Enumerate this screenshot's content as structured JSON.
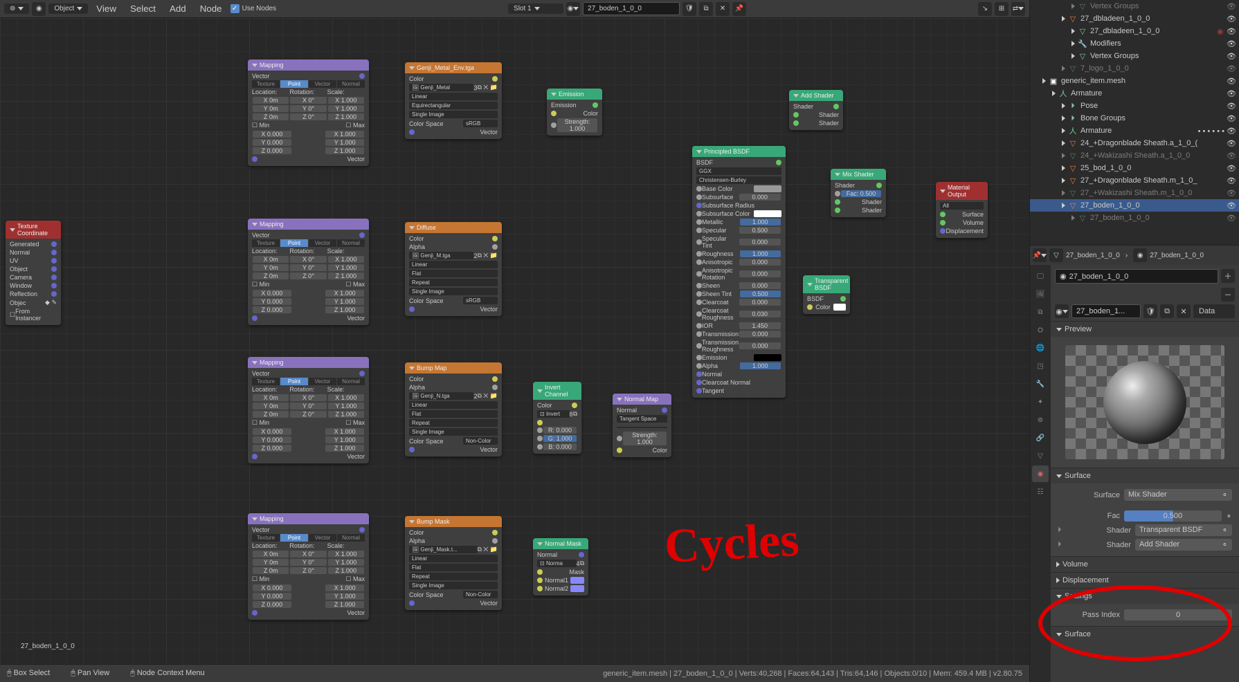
{
  "header": {
    "mode_label": "Object",
    "menu_view": "View",
    "menu_select": "Select",
    "menu_add": "Add",
    "menu_node": "Node",
    "use_nodes": "Use Nodes",
    "slot": "Slot 1",
    "material": "27_boden_1_0_0"
  },
  "breadcrumb": "27_boden_1_0_0",
  "tex_coord": {
    "title": "Texture Coordinate",
    "outs": [
      "Generated",
      "Normal",
      "UV",
      "Object",
      "Camera",
      "Window",
      "Reflection"
    ],
    "obj_lbl": "Objec",
    "inst": "From Instancer"
  },
  "mapping": {
    "title": "Mapping",
    "out": "Vector",
    "types": [
      "Texture",
      "Point",
      "Vector",
      "Normal"
    ],
    "loc": "Location:",
    "rot": "Rotation:",
    "scale": "Scale:",
    "xyz": [
      "X",
      "Y",
      "Z"
    ],
    "zeros": [
      "0m",
      "0°",
      "1.000"
    ],
    "min_lbl": "Min",
    "max_lbl": "Max",
    "minv": "0.000",
    "maxv": "1.000",
    "vec_in": "Vector"
  },
  "img_env": {
    "title": "Genji_Metal_Env.tga",
    "out": "Color",
    "name": "Genji_Metal",
    "users": "3",
    "interp": "Linear",
    "proj": "Equirectangular",
    "single": "Single Image",
    "cspace": "Color Space",
    "cs": "sRGB",
    "vec": "Vector"
  },
  "img_m": {
    "title": "Diffuse",
    "out": "Color",
    "out2": "Alpha",
    "name": "Genji_M.tga",
    "users": "2",
    "interp": "Linear",
    "proj": "Flat",
    "rep": "Repeat",
    "single": "Single Image",
    "cspace": "Color Space",
    "cs": "sRGB",
    "vec": "Vector"
  },
  "img_n": {
    "title": "Bump Map",
    "out": "Color",
    "out2": "Alpha",
    "name": "Genji_N.tga",
    "users": "2",
    "interp": "Linear",
    "proj": "Flat",
    "rep": "Repeat",
    "single": "Single Image",
    "cspace": "Color Space",
    "cs": "Non-Color",
    "vec": "Vector"
  },
  "img_mask": {
    "title": "Bump Mask",
    "out": "Color",
    "out2": "Alpha",
    "name": "Genji_Mask.t...",
    "users": "",
    "interp": "Linear",
    "proj": "Flat",
    "rep": "Repeat",
    "single": "Single Image",
    "cspace": "Color Space",
    "cs": "Non-Color",
    "vec": "Vector"
  },
  "emission": {
    "title": "Emission",
    "out": "Emission",
    "color": "Color",
    "strength": "Strength:",
    "sval": "1.000"
  },
  "invert": {
    "title": "Invert Channel",
    "out": "Color",
    "invert": "Invert",
    "users": "8",
    "r": "R:",
    "rv": "0.000",
    "g": "G:",
    "gv": "1.000",
    "b": "B:",
    "bv": "0.000"
  },
  "normal_map": {
    "title": "Normal Map",
    "out": "Normal",
    "space": "Tangent Space",
    "strength": "Strength:",
    "sv": "1.000",
    "color": "Color"
  },
  "normal_mask": {
    "title": "Normal Mask",
    "out": "Normal",
    "norma": "Norma",
    "users": "4",
    "mask": "Mask",
    "n1": "Normal1",
    "n2": "Normal2"
  },
  "bsdf": {
    "title": "Principled BSDF",
    "out": "BSDF",
    "dist": "GGX",
    "sss": "Christensen-Burley",
    "rows": [
      [
        "Base Color",
        "swatch",
        "#999"
      ],
      [
        "Subsurface",
        "num",
        "0.000"
      ],
      [
        "Subsurface Radius",
        "vec",
        ""
      ],
      [
        "Subsurface Color",
        "swatch",
        "#fff"
      ],
      [
        "Metallic",
        "hl",
        "1.000"
      ],
      [
        "Specular",
        "num",
        "0.500"
      ],
      [
        "Specular Tint",
        "num",
        "0.000"
      ],
      [
        "Roughness",
        "hl",
        "1.000"
      ],
      [
        "Anisotropic",
        "num",
        "0.000"
      ],
      [
        "Anisotropic Rotation",
        "num",
        "0.000"
      ],
      [
        "Sheen",
        "num",
        "0.000"
      ],
      [
        "Sheen Tint",
        "hl",
        "0.500"
      ],
      [
        "Clearcoat",
        "num",
        "0.000"
      ],
      [
        "Clearcoat Roughness",
        "num",
        "0.030"
      ],
      [
        "IOR",
        "num",
        "1.450"
      ],
      [
        "Transmission",
        "num",
        "0.000"
      ],
      [
        "Transmission Roughness",
        "num",
        "0.000"
      ],
      [
        "Emission",
        "swatch",
        "#000"
      ],
      [
        "Alpha",
        "hl",
        "1.000"
      ],
      [
        "Normal",
        "",
        ""
      ],
      [
        "Clearcoat Normal",
        "",
        ""
      ],
      [
        "Tangent",
        "",
        ""
      ]
    ]
  },
  "transp": {
    "title": "Transparent BSDF",
    "out": "BSDF",
    "color": "Color"
  },
  "add": {
    "title": "Add Shader",
    "out": "Shader",
    "s1": "Shader",
    "s2": "Shader"
  },
  "mix": {
    "title": "Mix Shader",
    "out": "Shader",
    "fac": "Fac:",
    "fv": "0.500",
    "s1": "Shader",
    "s2": "Shader"
  },
  "matout": {
    "title": "Material Output",
    "target": "All",
    "surface": "Surface",
    "volume": "Volume",
    "disp": "Displacement"
  },
  "outliner": [
    {
      "ind": 4,
      "ico": "▽",
      "name": "Vertex Groups",
      "dim": true
    },
    {
      "ind": 3,
      "ico": "▽",
      "name": "27_dbladeen_1_0_0",
      "mesh": true
    },
    {
      "ind": 4,
      "ico": "▽",
      "name": "27_dbladeen_1_0_0",
      "mat": true
    },
    {
      "ind": 4,
      "ico": "🔧",
      "name": "Modifiers"
    },
    {
      "ind": 4,
      "ico": "▽",
      "name": "Vertex Groups"
    },
    {
      "ind": 3,
      "ico": "▽",
      "name": "7_logo_1_0_0",
      "dim": true
    },
    {
      "ind": 1,
      "ico": "▣",
      "name": "generic_item.mesh",
      "coll": true
    },
    {
      "ind": 2,
      "ico": "人",
      "name": "Armature"
    },
    {
      "ind": 3,
      "ico": "⏵",
      "name": "Pose"
    },
    {
      "ind": 3,
      "ico": "⏵",
      "name": "Bone Groups"
    },
    {
      "ind": 3,
      "ico": "人",
      "name": "Armature",
      "dots": true
    },
    {
      "ind": 3,
      "ico": "▽",
      "name": "24_+Dragonblade Sheath.a_1_0_(",
      "mesh": true
    },
    {
      "ind": 3,
      "ico": "▽",
      "name": "24_+Wakizashi Sheath.a_1_0_0",
      "dim": true
    },
    {
      "ind": 3,
      "ico": "▽",
      "name": "25_bod_1_0_0",
      "mesh": true
    },
    {
      "ind": 3,
      "ico": "▽",
      "name": "27_+Dragonblade Sheath.m_1_0_",
      "mesh": true
    },
    {
      "ind": 3,
      "ico": "▽",
      "name": "27_+Wakizashi Sheath.m_1_0_0",
      "dim": true
    },
    {
      "ind": 3,
      "ico": "▽",
      "name": "27_boden_1_0_0",
      "sel": true,
      "mesh": true
    },
    {
      "ind": 4,
      "ico": "▽",
      "name": "27_boden_1_0_0",
      "dim": true
    }
  ],
  "props": {
    "obj": "27_boden_1_0_0",
    "data": "27_boden_1_0_0",
    "mat_name": "27_boden_1_0_0",
    "mat_link": "27_boden_1...",
    "data_link": "Data",
    "preview": "Preview",
    "surface": "Surface",
    "surface_lbl": "Surface",
    "surface_val": "Mix Shader",
    "fac_lbl": "Fac",
    "fac_val": "0.500",
    "sh1_lbl": "Shader",
    "sh1_val": "Transparent BSDF",
    "sh2_lbl": "Shader",
    "sh2_val": "Add Shader",
    "volume": "Volume",
    "disp": "Displacement",
    "settings": "Settings",
    "pass": "Pass Index",
    "pass_val": "0",
    "surface2": "Surface"
  },
  "status": {
    "box": "Box Select",
    "pan": "Pan View",
    "ctx": "Node Context Menu",
    "info": "generic_item.mesh | 27_boden_1_0_0 | Verts:40,268 | Faces:64,143 | Tris:64,146 | Objects:0/10 | Mem: 459.4 MB | v2.80.75"
  },
  "annotation": "Cycles"
}
